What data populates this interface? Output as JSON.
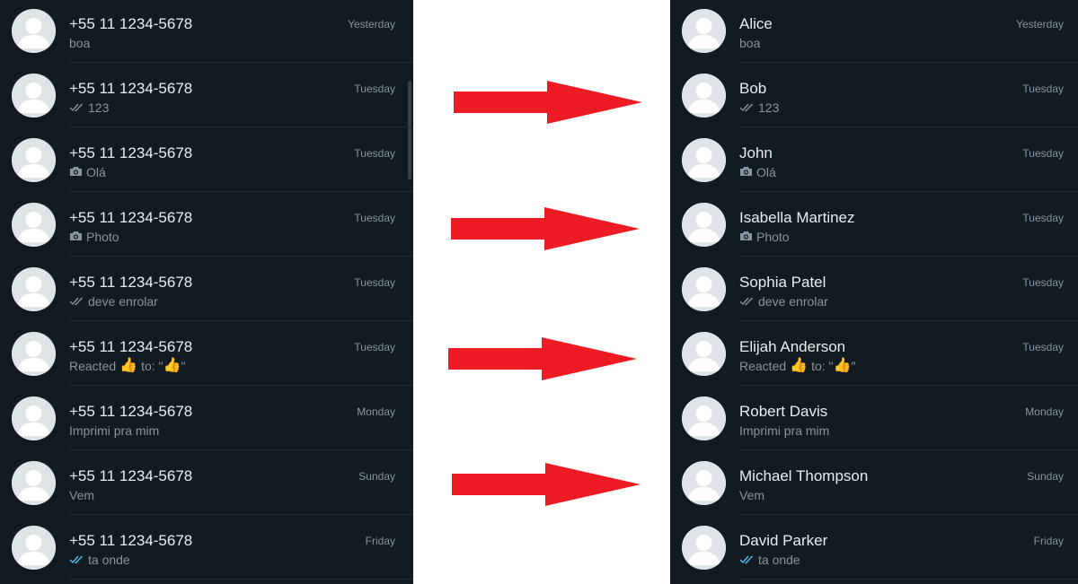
{
  "left_panel": {
    "chats": [
      {
        "name": "+55 11 1234-5678",
        "time": "Yesterday",
        "preview": "boa",
        "status": "none"
      },
      {
        "name": "+55 11 1234-5678",
        "time": "Tuesday",
        "preview": "123",
        "status": "read-grey"
      },
      {
        "name": "+55 11 1234-5678",
        "time": "Tuesday",
        "preview": "Olá",
        "status": "camera"
      },
      {
        "name": "+55 11 1234-5678",
        "time": "Tuesday",
        "preview": "Photo",
        "status": "camera"
      },
      {
        "name": "+55 11 1234-5678",
        "time": "Tuesday",
        "preview": "deve enrolar",
        "status": "read-grey"
      },
      {
        "name": "+55 11 1234-5678",
        "time": "Tuesday",
        "preview": "Reacted",
        "status": "reaction",
        "reaction_to": "to: \"",
        "reaction_end": "\"",
        "emoji": "👍"
      },
      {
        "name": "+55 11 1234-5678",
        "time": "Monday",
        "preview": "Imprimi pra mim",
        "status": "none"
      },
      {
        "name": "+55 11 1234-5678",
        "time": "Sunday",
        "preview": "Vem",
        "status": "none"
      },
      {
        "name": "+55 11 1234-5678",
        "time": "Friday",
        "preview": "ta onde",
        "status": "read-blue"
      }
    ]
  },
  "right_panel": {
    "chats": [
      {
        "name": "Alice",
        "time": "Yesterday",
        "preview": "boa",
        "status": "none"
      },
      {
        "name": "Bob",
        "time": "Tuesday",
        "preview": "123",
        "status": "read-grey"
      },
      {
        "name": "John",
        "time": "Tuesday",
        "preview": "Olá",
        "status": "camera"
      },
      {
        "name": "Isabella Martinez",
        "time": "Tuesday",
        "preview": "Photo",
        "status": "camera"
      },
      {
        "name": "Sophia Patel",
        "time": "Tuesday",
        "preview": "deve enrolar",
        "status": "read-grey"
      },
      {
        "name": "Elijah Anderson",
        "time": "Tuesday",
        "preview": "Reacted",
        "status": "reaction",
        "reaction_to": "to: \"",
        "reaction_end": "\"",
        "emoji": "👍"
      },
      {
        "name": "Robert Davis",
        "time": "Monday",
        "preview": "Imprimi pra mim",
        "status": "none"
      },
      {
        "name": "Michael Thompson",
        "time": "Sunday",
        "preview": "Vem",
        "status": "none"
      },
      {
        "name": "David Parker",
        "time": "Friday",
        "preview": "ta onde",
        "status": "read-blue"
      }
    ]
  },
  "colors": {
    "panel_bg": "#111b21",
    "name_text": "#e9edef",
    "secondary_text": "#8696a0",
    "read_tick_blue": "#53bdeb",
    "arrow_red": "#ed1c24"
  },
  "arrows": {
    "count": 4,
    "icon": "right-arrow-icon"
  }
}
